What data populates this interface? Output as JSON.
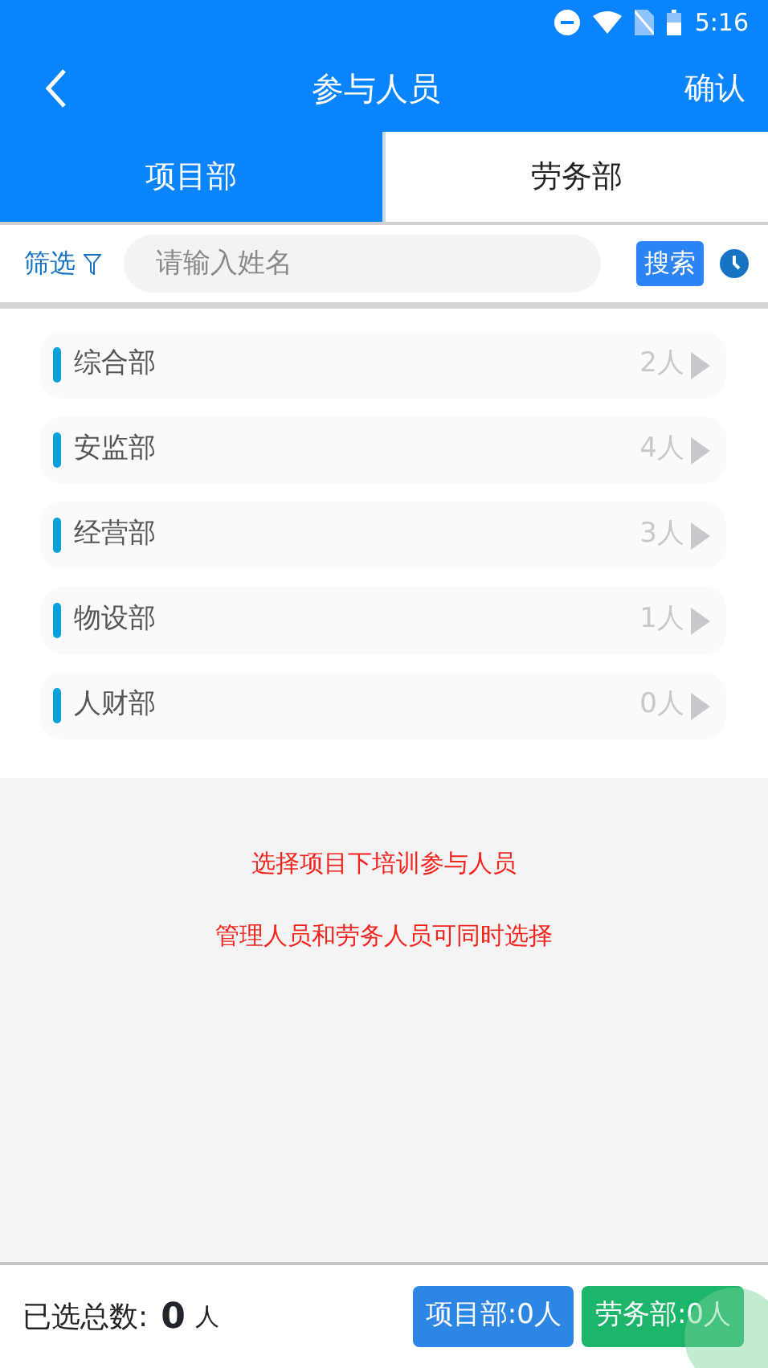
{
  "status_bar": {
    "time": "5:16"
  },
  "header": {
    "title": "参与人员",
    "confirm": "确认"
  },
  "tabs": [
    {
      "label": "项目部",
      "selected": true
    },
    {
      "label": "劳务部",
      "selected": false
    }
  ],
  "search": {
    "filter": "筛选",
    "placeholder": "请输入姓名",
    "button": "搜索"
  },
  "departments": [
    {
      "name": "综合部",
      "count": "2人"
    },
    {
      "name": "安监部",
      "count": "4人"
    },
    {
      "name": "经营部",
      "count": "3人"
    },
    {
      "name": "物设部",
      "count": "1人"
    },
    {
      "name": "人财部",
      "count": "0人"
    }
  ],
  "hints": [
    "选择项目下培训参与人员",
    "管理人员和劳务人员可同时选择"
  ],
  "footer": {
    "label": "已选总数:",
    "total": "0",
    "unit": "人",
    "buttons": [
      {
        "label": "项目部:0人",
        "color": "#2e86e4"
      },
      {
        "label": "劳务部:0人",
        "color": "#1db569"
      }
    ]
  }
}
